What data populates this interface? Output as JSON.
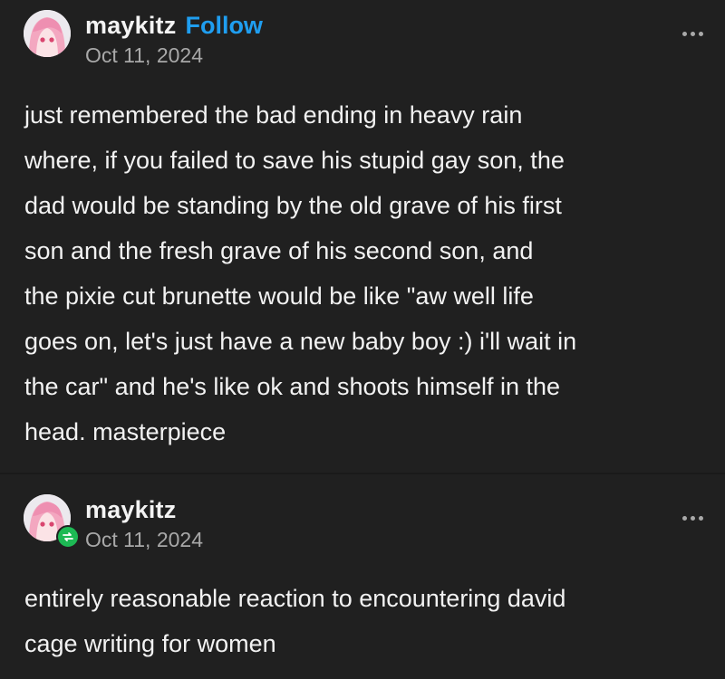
{
  "posts": [
    {
      "username": "maykitz",
      "follow_label": "Follow",
      "date": "Oct 11, 2024",
      "body": "just remembered the bad ending in heavy rain\nwhere, if you failed to save his stupid gay son, the\ndad would be standing by the old grave of his first\nson and the fresh grave of his second son, and\nthe pixie cut brunette would be like \"aw well life\ngoes on, let's just have a new baby boy :) i'll wait in\nthe car\" and he's like ok and shoots himself in the\nhead. masterpiece",
      "avatar_icon": "anime-avatar",
      "more_icon": "ellipsis-icon"
    },
    {
      "username": "maykitz",
      "date": "Oct 11, 2024",
      "body": "entirely reasonable reaction to encountering david\ncage writing for women",
      "avatar_icon": "anime-avatar",
      "badge_icon": "reblog-icon",
      "more_icon": "ellipsis-icon"
    }
  ],
  "colors": {
    "background": "#202020",
    "text": "#f2f2f2",
    "muted": "#a8a8a8",
    "follow": "#1f9ef0",
    "reblog_badge": "#1db954"
  }
}
